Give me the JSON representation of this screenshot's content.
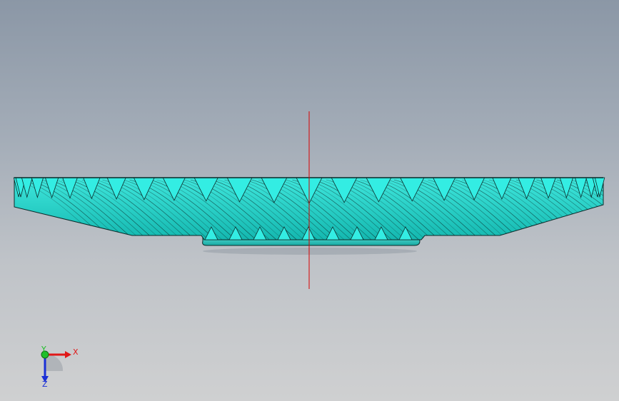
{
  "viewport": {
    "background_top": "#8b97a6",
    "background_bottom": "#cfd0d1"
  },
  "model": {
    "part_icon": "spiral-bevel-gear-icon",
    "face_color": "#1fd6cc",
    "tooth_color": "#33ede3",
    "edge_color": "#0b2b2a",
    "centerline_color": "#d80000"
  },
  "triad": {
    "x_label": "X",
    "y_label": "Y",
    "z_label": "Z",
    "x_color": "#e01818",
    "y_color": "#1fbf2a",
    "z_color": "#1a2fd6"
  }
}
